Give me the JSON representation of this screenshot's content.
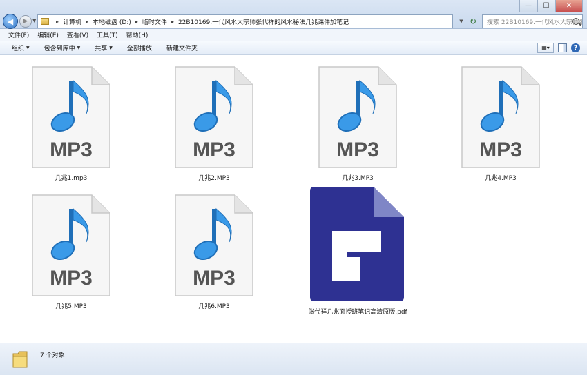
{
  "window": {
    "minimize_glyph": "—",
    "maximize_glyph": "☐",
    "close_glyph": "✕"
  },
  "address_bar": {
    "breadcrumbs": [
      {
        "label": "计算机"
      },
      {
        "label": "本地磁盘 (D:)"
      },
      {
        "label": "临时文件"
      },
      {
        "label": "22B10169.一代风水大宗师张代祥的风水秘法几兆课件加笔记"
      }
    ]
  },
  "search": {
    "placeholder": "搜索 22B10169.一代风水大宗师张代..."
  },
  "menu": {
    "items": [
      {
        "label": "文件(F)"
      },
      {
        "label": "编辑(E)"
      },
      {
        "label": "查看(V)"
      },
      {
        "label": "工具(T)"
      },
      {
        "label": "帮助(H)"
      }
    ]
  },
  "toolbar": {
    "organize_label": "组织",
    "include_label": "包含到库中",
    "share_label": "共享",
    "play_all_label": "全部播放",
    "new_folder_label": "新建文件夹"
  },
  "files": [
    {
      "name": "几兆1.mp3",
      "type": "mp3",
      "icon_text": "MP3"
    },
    {
      "name": "几兆2.MP3",
      "type": "mp3",
      "icon_text": "MP3"
    },
    {
      "name": "几兆3.MP3",
      "type": "mp3",
      "icon_text": "MP3"
    },
    {
      "name": "几兆4.MP3",
      "type": "mp3",
      "icon_text": "MP3"
    },
    {
      "name": "几兆5.MP3",
      "type": "mp3",
      "icon_text": "MP3"
    },
    {
      "name": "几兆6.MP3",
      "type": "mp3",
      "icon_text": "MP3"
    },
    {
      "name": "张代祥几兆面授班笔记高清原版.pdf",
      "type": "pdf"
    }
  ],
  "status": {
    "count_text": "7 个对象"
  },
  "colors": {
    "pdf_blue": "#2e3192",
    "note_blue": "#2a8fe0",
    "mp3_text": "#555555"
  }
}
